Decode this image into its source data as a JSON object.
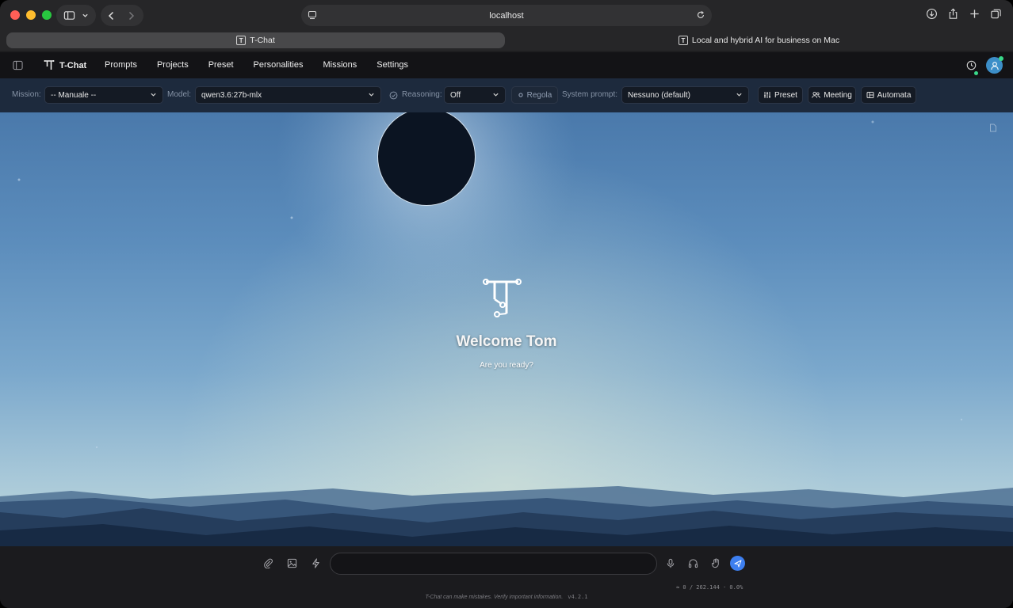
{
  "browser": {
    "address": "localhost",
    "tabs": [
      {
        "label": "T-Chat",
        "favicon": "T",
        "active": true
      },
      {
        "label": "Local and hybrid AI for business on Mac",
        "favicon": "T",
        "active": false
      }
    ]
  },
  "app": {
    "brand": "T-Chat",
    "nav": [
      "Prompts",
      "Projects",
      "Preset",
      "Personalities",
      "Missions",
      "Settings"
    ]
  },
  "toolbar": {
    "mission_label": "Mission:",
    "mission_value": "-- Manuale --",
    "model_label": "Model:",
    "model_value": "qwen3.6:27b-mlx",
    "reasoning_label": "Reasoning:",
    "reasoning_value": "Off",
    "regola_label": "Regola",
    "system_prompt_label": "System prompt:",
    "system_prompt_value": "Nessuno (default)",
    "preset_button": "Preset",
    "meeting_button": "Meeting",
    "automata_button": "Automata"
  },
  "hero": {
    "welcome": "Welcome Tom",
    "subtitle": "Are you ready?"
  },
  "composer": {
    "placeholder": "",
    "tokens": "≈ 0 / 262.144 · 0.0%",
    "disclaimer": "T-Chat can make mistakes. Verify important information.",
    "version": "v4.2.1"
  },
  "colors": {
    "accent": "#3d7ff0",
    "status_online": "#39d98a",
    "toolbar_bg": "#1d2a3d"
  }
}
